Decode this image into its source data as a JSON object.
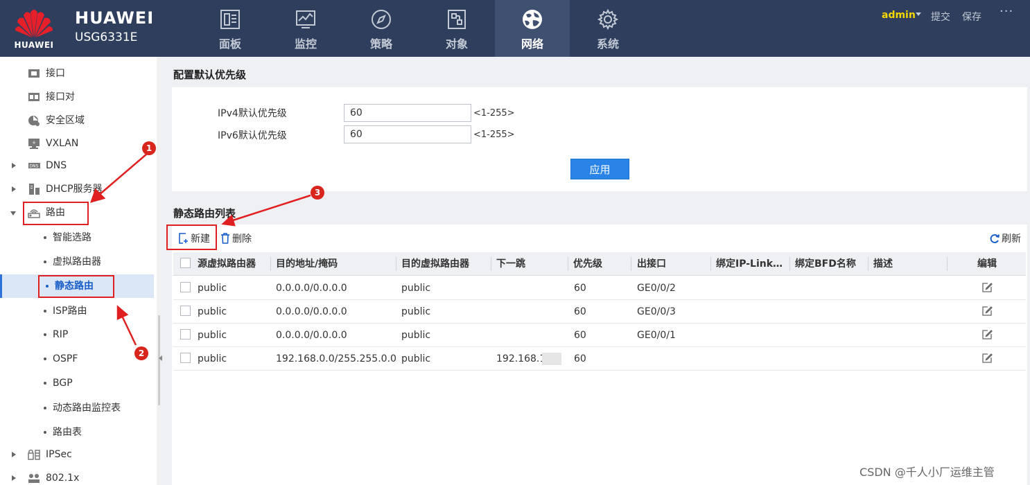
{
  "header": {
    "logo_text": "HUAWEI",
    "brand_name": "HUAWEI",
    "model": "USG6331E",
    "tabs": [
      {
        "label": "面板",
        "icon": "dashboard-icon",
        "active": false
      },
      {
        "label": "监控",
        "icon": "monitor-icon",
        "active": false
      },
      {
        "label": "策略",
        "icon": "compass-icon",
        "active": false
      },
      {
        "label": "对象",
        "icon": "object-icon",
        "active": false
      },
      {
        "label": "网络",
        "icon": "network-globe-icon",
        "active": true
      },
      {
        "label": "系统",
        "icon": "gear-icon",
        "active": false
      }
    ],
    "user": "admin",
    "submit": "提交",
    "save": "保存",
    "more": "···"
  },
  "sidebar": {
    "items": [
      {
        "label": "接口",
        "icon": "interface-icon"
      },
      {
        "label": "接口对",
        "icon": "interface-pair-icon"
      },
      {
        "label": "安全区域",
        "icon": "security-zone-icon"
      },
      {
        "label": "VXLAN",
        "icon": "vxlan-icon"
      },
      {
        "label": "DNS",
        "icon": "dns-icon",
        "expandable": true
      },
      {
        "label": "DHCP服务器",
        "icon": "dhcp-server-icon",
        "expandable": true
      },
      {
        "label": "路由",
        "icon": "router-icon",
        "expandable": true,
        "expanded": true
      },
      {
        "label": "智能选路",
        "sub": true
      },
      {
        "label": "虚拟路由器",
        "sub": true
      },
      {
        "label": "静态路由",
        "sub": true,
        "selected": true
      },
      {
        "label": "ISP路由",
        "sub": true
      },
      {
        "label": "RIP",
        "sub": true
      },
      {
        "label": "OSPF",
        "sub": true
      },
      {
        "label": "BGP",
        "sub": true
      },
      {
        "label": "动态路由监控表",
        "sub": true
      },
      {
        "label": "路由表",
        "sub": true
      },
      {
        "label": "IPSec",
        "icon": "ipsec-icon",
        "expandable": true
      },
      {
        "label": "802.1x",
        "icon": "dot1x-icon",
        "expandable": true
      }
    ]
  },
  "priority": {
    "title": "配置默认优先级",
    "ipv4_label": "IPv4默认优先级",
    "ipv4_value": "60",
    "ipv6_label": "IPv6默认优先级",
    "ipv6_value": "60",
    "range_hint": "<1-255>",
    "apply": "应用"
  },
  "routes": {
    "title": "静态路由列表",
    "new": "新建",
    "delete": "删除",
    "refresh": "刷新",
    "columns": [
      "源虚拟路由器",
      "目的地址/掩码",
      "目的虚拟路由器",
      "下一跳",
      "优先级",
      "出接口",
      "绑定IP-Link…",
      "绑定BFD名称",
      "描述",
      "编辑"
    ],
    "rows": [
      {
        "src_vr": "public",
        "dest": "0.0.0.0/0.0.0.0",
        "dest_vr": "public",
        "next_hop": "",
        "priority": "60",
        "out_if": "GE0/0/2"
      },
      {
        "src_vr": "public",
        "dest": "0.0.0.0/0.0.0.0",
        "dest_vr": "public",
        "next_hop": "",
        "priority": "60",
        "out_if": "GE0/0/3"
      },
      {
        "src_vr": "public",
        "dest": "0.0.0.0/0.0.0.0",
        "dest_vr": "public",
        "next_hop": "",
        "priority": "60",
        "out_if": "GE0/0/1"
      },
      {
        "src_vr": "public",
        "dest": "192.168.0.0/255.255.0.0",
        "dest_vr": "public",
        "next_hop": "192.168.1",
        "priority": "60",
        "out_if": ""
      }
    ]
  },
  "annotations": {
    "step1": "1",
    "step2": "2",
    "step3": "3",
    "color": "#e02020"
  },
  "watermark": "CSDN @千人小厂运维主管"
}
